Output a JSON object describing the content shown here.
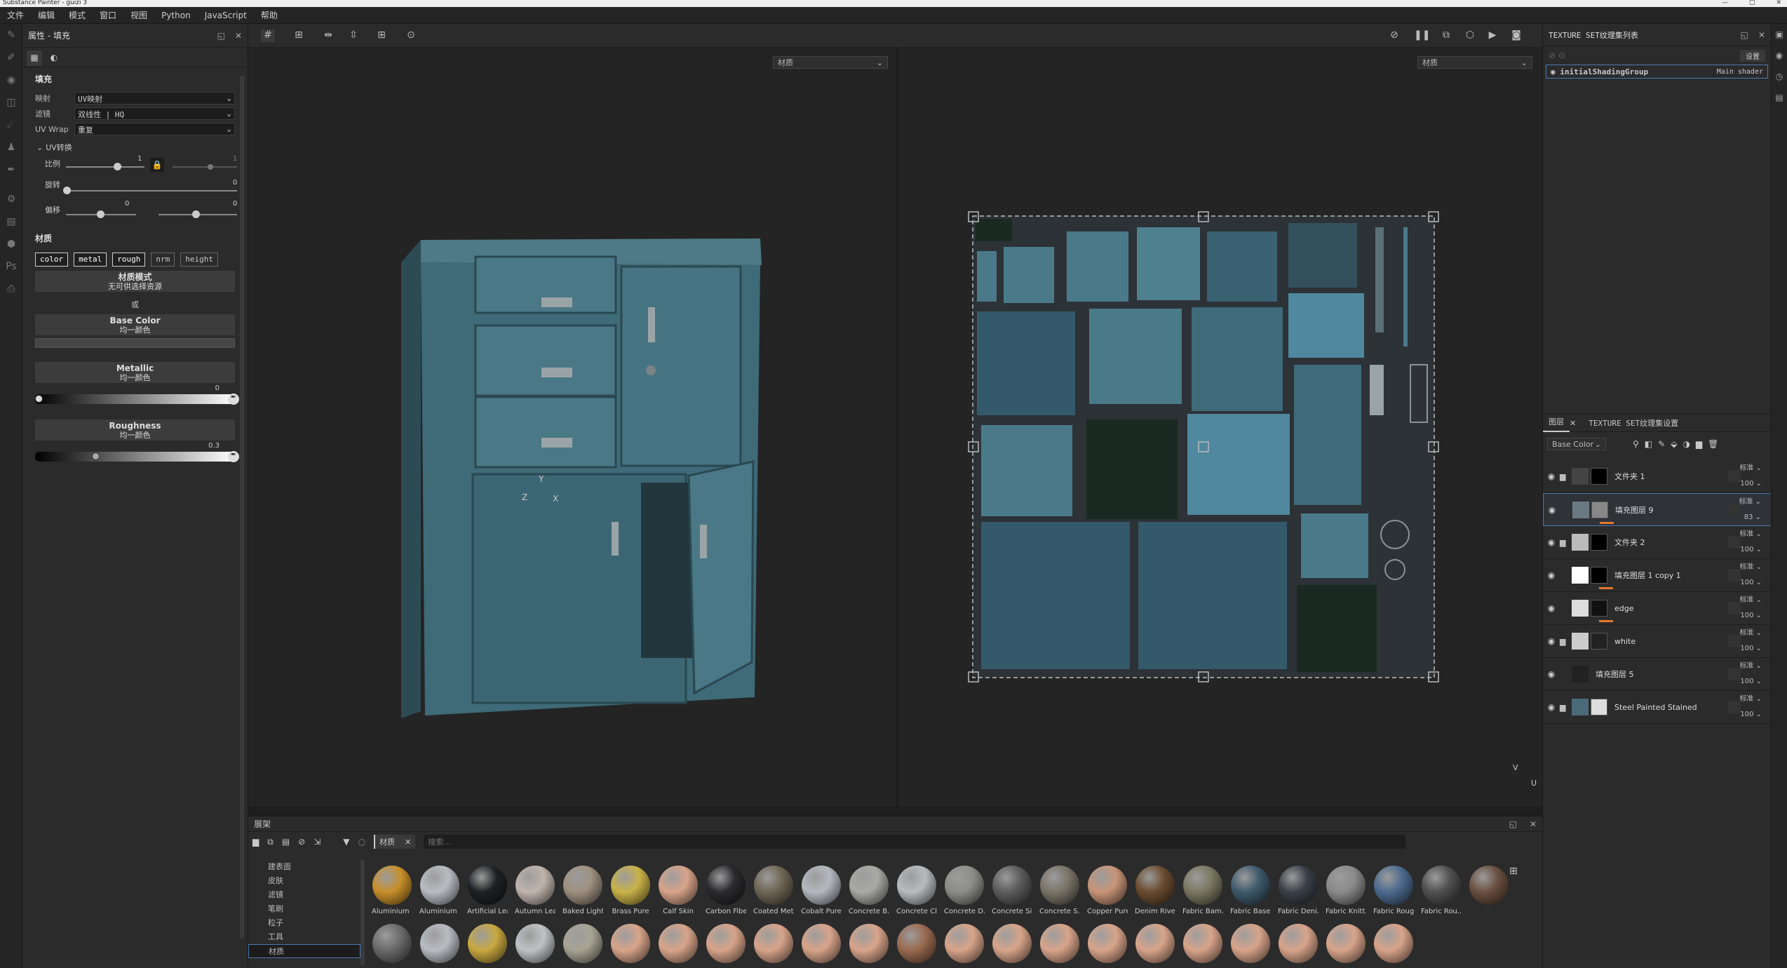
{
  "window": {
    "title": "Substance Painter - guizi 3",
    "controls": [
      "—",
      "□",
      "✕"
    ]
  },
  "menu": [
    "文件",
    "编辑",
    "模式",
    "窗口",
    "视图",
    "Python",
    "JavaScript",
    "帮助"
  ],
  "props": {
    "title": "属性 - 填充",
    "section_fill": "填充",
    "projection_label": "映射",
    "projection_value": "UV映射",
    "filter_label": "滤镜",
    "filter_value": "双线性 | HQ",
    "uvwrap_label": "UV Wrap",
    "uvwrap_value": "重复",
    "uvtransform_label": "UV转换",
    "scale_label": "比例",
    "scale_value": "1",
    "scale_value2": "1",
    "rotate_label": "旋转",
    "rotate_value": "0",
    "offset_label": "偏移",
    "offset_value1": "0",
    "offset_value2": "0",
    "material_section": "材质",
    "channels": [
      "color",
      "metal",
      "rough",
      "nrm",
      "height"
    ],
    "material_mode_title": "材质模式",
    "material_mode_sub": "无可供选择资源",
    "or_label": "或",
    "base_color_title": "Base Color",
    "base_color_sub": "均一颜色",
    "metallic_title": "Metallic",
    "metallic_sub": "均一颜色",
    "metallic_value": "0",
    "metallic_level": 0,
    "roughness_title": "Roughness",
    "roughness_sub": "均一颜色",
    "roughness_value": "0.3",
    "roughness_level": 0.3
  },
  "viewport": {
    "material_dd_3d": "材质",
    "material_dd_2d": "材质"
  },
  "shelf": {
    "title": "展架",
    "tab_label": "材质",
    "search_placeholder": "搜索...",
    "categories": [
      "建表面",
      "皮肤",
      "滤镜",
      "笔刷",
      "粒子",
      "工具",
      "材质"
    ],
    "selected_category": "材质",
    "materials": [
      {
        "name": "Aluminium ...",
        "color": "#c8902a"
      },
      {
        "name": "Aluminium ...",
        "color": "#b8bcc2"
      },
      {
        "name": "Artificial Lea...",
        "color": "#1e2124"
      },
      {
        "name": "Autumn Leaf",
        "color": "#c0b4ac"
      },
      {
        "name": "Baked Light...",
        "color": "#9e9080"
      },
      {
        "name": "Brass Pure",
        "color": "#c9b248"
      },
      {
        "name": "Calf Skin",
        "color": "#d8a48a"
      },
      {
        "name": "Carbon Fiber",
        "color": "#2a2a2c"
      },
      {
        "name": "Coated Metal",
        "color": "#6e6654"
      },
      {
        "name": "Cobalt Pure",
        "color": "#b4b8c0"
      },
      {
        "name": "Concrete B...",
        "color": "#a8a8a4"
      },
      {
        "name": "Concrete Cl...",
        "color": "#b8babc"
      },
      {
        "name": "Concrete D...",
        "color": "#8c8c8a"
      },
      {
        "name": "Concrete Si...",
        "color": "#5c5c5c"
      },
      {
        "name": "Concrete S...",
        "color": "#7a7468"
      },
      {
        "name": "Copper Pure",
        "color": "#c89478"
      },
      {
        "name": "Denim Rivet",
        "color": "#6a4c30"
      },
      {
        "name": "Fabric Bam...",
        "color": "#7a7860"
      },
      {
        "name": "Fabric Base...",
        "color": "#3e5a6c"
      },
      {
        "name": "Fabric Deni...",
        "color": "#3a4048"
      },
      {
        "name": "Fabric Knitt...",
        "color": "#8a8a8a"
      },
      {
        "name": "Fabric Rough",
        "color": "#4c6a8e"
      },
      {
        "name": "Fabric Rou...",
        "color": "#505050"
      }
    ],
    "row2_colors": [
      "#6a5040",
      "#6a6a6a",
      "#b8bcc2",
      "#c9a840",
      "#c0c2c6",
      "#a8a494",
      "#d8a48a",
      "#d8a48a",
      "#d8a48a",
      "#d8a48a",
      "#d8a48a",
      "#d8a48a",
      "#9a6a50",
      "#d8a48a",
      "#d8a48a",
      "#d8a48a",
      "#d8a48a",
      "#d8a48a",
      "#d8a48a",
      "#d8a48a",
      "#d8a48a",
      "#d8a48a",
      "#d8a48a"
    ]
  },
  "texset_list": {
    "title": "TEXTURE SET纹理集列表",
    "settings_btn": "设置",
    "item_name": "initialShadingGroup",
    "item_shader": "Main shader"
  },
  "layers": {
    "tab_layers": "图层",
    "tab_settings": "TEXTURE SET纹理集设置",
    "channel_dd": "Base Color",
    "items": [
      {
        "name": "文件夹 1",
        "blend": "标准",
        "opacity": "100",
        "folder": true,
        "thumb": "#444",
        "mask": "#000"
      },
      {
        "name": "填充图层 9",
        "blend": "标准",
        "opacity": "83",
        "folder": false,
        "selected": true,
        "thumb": "#6a7a82",
        "mask": "#888"
      },
      {
        "name": "文件夹 2",
        "blend": "标准",
        "opacity": "100",
        "folder": true,
        "thumb": "#bbb",
        "mask": "#000"
      },
      {
        "name": "填充图层 1 copy 1",
        "blend": "标准",
        "opacity": "100",
        "folder": false,
        "thumb": "#fff",
        "mask": "#000"
      },
      {
        "name": "edge",
        "blend": "标准",
        "opacity": "100",
        "folder": false,
        "thumb": "#ddd",
        "mask": "#111"
      },
      {
        "name": "white",
        "blend": "标准",
        "opacity": "100",
        "folder": true,
        "thumb": "#ccc",
        "mask": "#222"
      },
      {
        "name": "填充图层 5",
        "blend": "标准",
        "opacity": "100",
        "folder": false,
        "thumb": "#222",
        "mask": ""
      },
      {
        "name": "Steel Painted Stained",
        "blend": "标准",
        "opacity": "100",
        "folder": true,
        "thumb": "#4a6a7a",
        "mask": "#ddd"
      }
    ]
  },
  "axes3d": {
    "y": "Y",
    "z": "Z",
    "x": "X"
  },
  "axes2d": {
    "v": "V",
    "u": "U"
  },
  "colors": {
    "accent": "#e07a2e",
    "cabinet": "#3f6a78",
    "select": "#4a7ab0"
  }
}
